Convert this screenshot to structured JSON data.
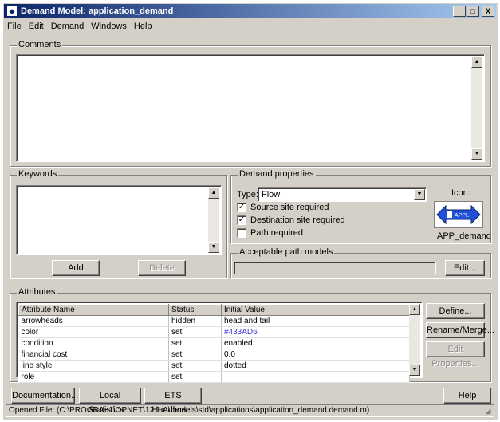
{
  "window": {
    "title": "Demand Model: application_demand",
    "minimize": "_",
    "maximize": "□",
    "close": "X"
  },
  "menu": [
    "File",
    "Edit",
    "Demand",
    "Windows",
    "Help"
  ],
  "comments": {
    "label": "Comments",
    "value": ""
  },
  "keywords": {
    "label": "Keywords",
    "add": "Add",
    "delete": "Delete"
  },
  "demand_properties": {
    "label": "Demand properties",
    "type_label": "Type:",
    "type_value": "Flow",
    "icon_label": "Icon:",
    "icon_text": "APPL",
    "icon_name": "APP_demand",
    "checkboxes": [
      {
        "label": "Source site required",
        "checked": true
      },
      {
        "label": "Destination site required",
        "checked": true
      },
      {
        "label": "Path required",
        "checked": false
      }
    ]
  },
  "acceptable_paths": {
    "label": "Acceptable path models",
    "edit": "Edit..."
  },
  "attributes": {
    "label": "Attributes",
    "columns": [
      "Attribute Name",
      "Status",
      "Initial Value"
    ],
    "rows": [
      [
        "arrowheads",
        "hidden",
        "head and tail"
      ],
      [
        "color",
        "set",
        "#433AD6"
      ],
      [
        "condition",
        "set",
        "enabled"
      ],
      [
        "financial cost",
        "set",
        "0.0"
      ],
      [
        "line style",
        "set",
        "dotted"
      ],
      [
        "role",
        "set",
        ""
      ]
    ],
    "link_color": "#433AD6",
    "buttons": {
      "define": "Define...",
      "rename": "Rename/Merge...",
      "edit_properties": "Edit Properties..."
    }
  },
  "bottom_buttons": {
    "documentation": "Documentation...",
    "local_statistics": "Local Statistics...",
    "ets_handlers": "ETS Handlers...",
    "help": "Help"
  },
  "status": "Opened File: (C:\\PROGRA~1\\OPNET\\12.1.A\\models\\std\\applications\\application_demand.demand.m)",
  "colors": {
    "titlebar_start": "#0a246a",
    "titlebar_end": "#a6caf0",
    "face": "#d4d0c8",
    "icon_blue": "#2050d8"
  }
}
